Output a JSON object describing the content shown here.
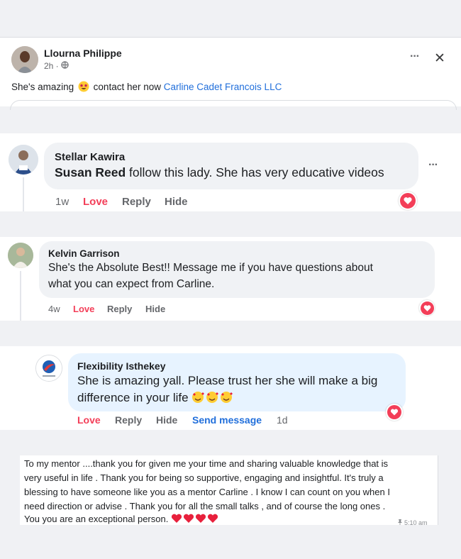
{
  "post": {
    "author": "Llourna Philippe",
    "time": "2h ·",
    "text_before": "She's amazing",
    "text_after": "contact her now",
    "tag_link": "Carline Cadet Francois LLC",
    "more_label": "···",
    "close_label": "✕"
  },
  "comments": [
    {
      "author": "Stellar Kawira",
      "mention": "Susan Reed",
      "text": " follow this lady. She has very educative videos",
      "age": "1w",
      "love": "Love",
      "reply": "Reply",
      "hide": "Hide",
      "more": "···"
    },
    {
      "author": "Kelvin Garrison",
      "text_line1": "She's the Absolute Best!! Message me if you have questions about",
      "text_line2": "what you can expect from Carline.",
      "age": "4w",
      "love": "Love",
      "reply": "Reply",
      "hide": "Hide"
    },
    {
      "author": "Flexibility Isthekey",
      "text_line1": "She is amazing yall. Please trust her she will make a big",
      "text_line2": "difference in your life",
      "love": "Love",
      "reply": "Reply",
      "hide": "Hide",
      "send": "Send message",
      "age": "1d"
    }
  ],
  "message": {
    "line1": "To my mentor ....thank you for given me your time and sharing valuable knowledge that is",
    "line2": "very useful in life . Thank you for being so supportive, engaging and insightful. It's truly a",
    "line3": "blessing to have someone like you as a mentor Carline . I know I can count on you when I",
    "line4": "need direction or advise . Thank you for all the small talks , and of course the long ones .",
    "line5": "You you are an exceptional person.",
    "time": "5:10 am"
  },
  "colors": {
    "link": "#216fdb",
    "love": "#f33e58",
    "meta": "#65676b",
    "bubble": "#f0f2f5",
    "bubble_blue": "#e7f3ff"
  },
  "icons": [
    "globe-icon",
    "more-icon",
    "close-icon",
    "heart-reaction-icon",
    "star-struck-emoji",
    "smiling-hearts-emoji",
    "red-heart-emoji"
  ]
}
